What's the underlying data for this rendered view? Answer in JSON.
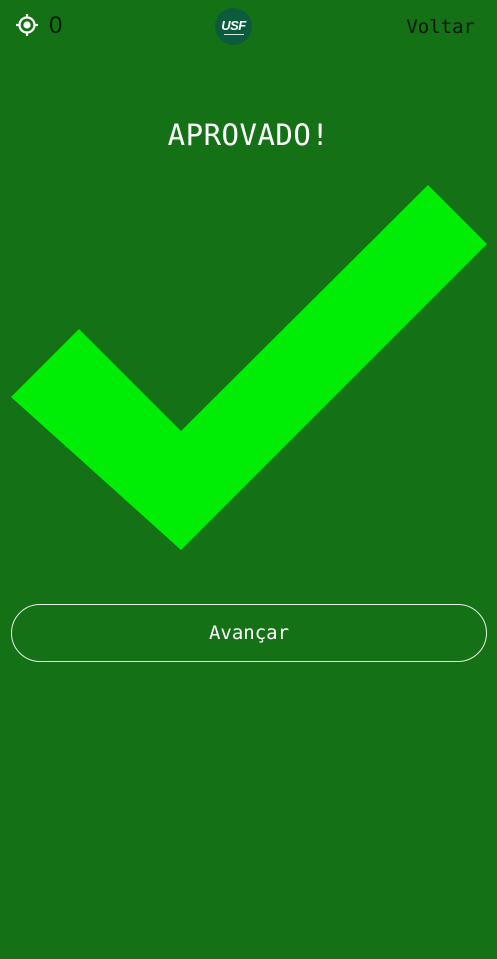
{
  "header": {
    "locate_icon": "crosshair-icon",
    "score": "0",
    "logo_text": "USF",
    "back_label": "Voltar"
  },
  "result": {
    "title": "APROVADO!",
    "icon": "checkmark-icon"
  },
  "actions": {
    "advance_label": "Avançar"
  },
  "colors": {
    "background": "#157116",
    "checkmark": "#00ee05",
    "logo_bg": "#0c5b3c",
    "text_dark": "#0a1a0a",
    "text_light": "#ffffff"
  }
}
